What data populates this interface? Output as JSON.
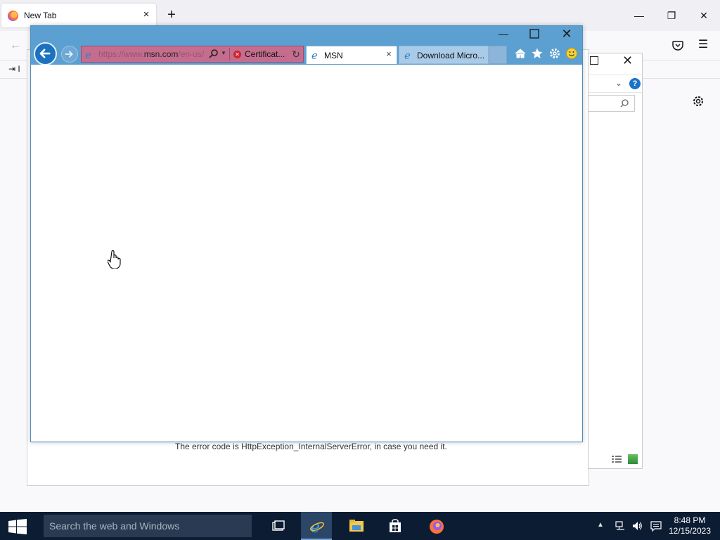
{
  "firefox": {
    "tab_title": "New Tab",
    "tab_close": "×",
    "new_tab": "+",
    "bookmark_item": "I",
    "window_controls": {
      "minimize": "—",
      "restore": "❐",
      "close": "✕"
    }
  },
  "background_dialog": {
    "error_text": "The error code is HttpException_InternalServerError, in case you need it."
  },
  "ie": {
    "window_controls": {
      "minimize": "—",
      "close": "✕"
    },
    "address": {
      "url_prefix": "https://www.",
      "url_domain": "msn.com",
      "url_suffix": "/en-us/",
      "cert_label": "Certificat..."
    },
    "tabs": [
      {
        "label": "MSN",
        "close": "×",
        "active": true
      },
      {
        "label": "Download Micro...",
        "active": false
      }
    ],
    "tools": [
      "home-icon",
      "favorites-star-icon",
      "tools-gear-icon",
      "smiley-feedback-icon"
    ]
  },
  "taskbar": {
    "search_placeholder": "Search the web and Windows",
    "time": "8:48 PM",
    "date": "12/15/2023",
    "apps": [
      "task-view",
      "internet-explorer",
      "file-explorer",
      "store",
      "firefox"
    ]
  },
  "colors": {
    "ie_chrome": "#5ba0d0",
    "address_bar_error": "#c46d8f",
    "taskbar": "#0c1c33"
  }
}
